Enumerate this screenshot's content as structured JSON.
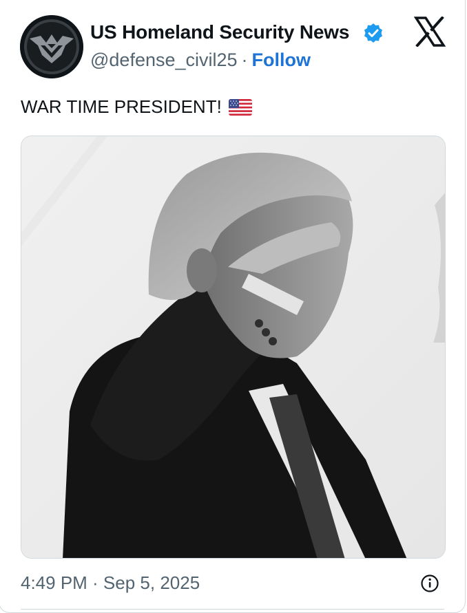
{
  "post": {
    "author": {
      "display_name": "US Homeland Security News",
      "handle": "@defense_civil25",
      "verified": true,
      "avatar_icon": "eagle-shield-logo"
    },
    "separator": "·",
    "follow_label": "Follow",
    "platform_icon": "x-logo-icon",
    "text": "WAR TIME PRESIDENT!",
    "emoji": "us-flag-emoji",
    "media": {
      "kind": "photo",
      "description_icon": "saluting-man-photo"
    },
    "timestamp": "4:49 PM · Sep 5, 2025",
    "info_icon": "info-icon"
  },
  "colors": {
    "text": "#0f1419",
    "secondary": "#536471",
    "link": "#1d73d6",
    "verified": "#1d9bf0",
    "border": "#cfd9de"
  }
}
